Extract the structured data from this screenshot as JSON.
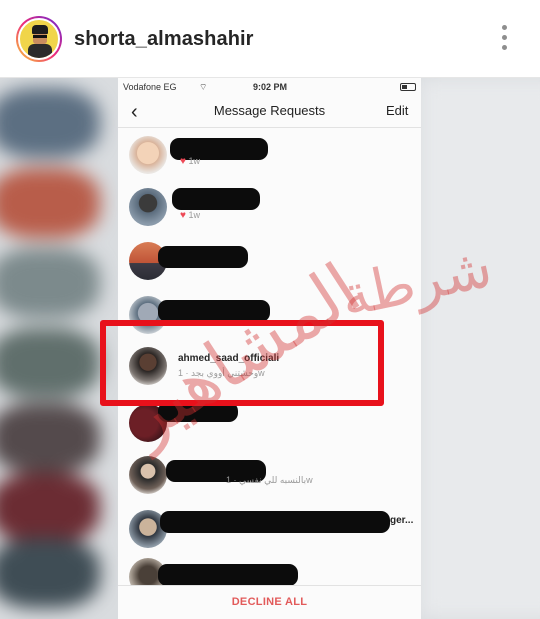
{
  "post_header": {
    "username": "shorta_almashahir",
    "avatar_icon": "policeman-avatar-icon",
    "more_icon": "more-vertical-icon"
  },
  "phone": {
    "status_bar": {
      "carrier": "Vodafone EG",
      "time": "9:02 PM"
    },
    "nav": {
      "back_icon": "chevron-left-icon",
      "title": "Message Requests",
      "edit_label": "Edit"
    },
    "requests": [
      {
        "name": "",
        "meta": "1w",
        "redacted": true
      },
      {
        "name": "",
        "meta": "1w",
        "redacted": true
      },
      {
        "name": "",
        "meta": "",
        "redacted": true
      },
      {
        "name": "",
        "meta": "",
        "redacted": true
      },
      {
        "name": "ahmed_saad_officiali",
        "meta": "وحشتني أووي بجد · 1w",
        "redacted": false,
        "highlighted": true
      },
      {
        "name": "",
        "meta": "",
        "redacted": true
      },
      {
        "name": "",
        "meta": "بالنسبه  للي نفسي · 1w",
        "redacted": true
      },
      {
        "name": "ger...",
        "meta": "",
        "redacted": true
      },
      {
        "name": "",
        "meta": "",
        "redacted": true
      }
    ],
    "decline_label": "DECLINE ALL"
  },
  "watermark": {
    "line1": "شرطة",
    "line2": "المشاهير"
  },
  "colors": {
    "highlight_border": "#e8111b",
    "watermark": "#d23232",
    "decline_text": "#e25a5a",
    "like_heart": "#ed4956"
  }
}
